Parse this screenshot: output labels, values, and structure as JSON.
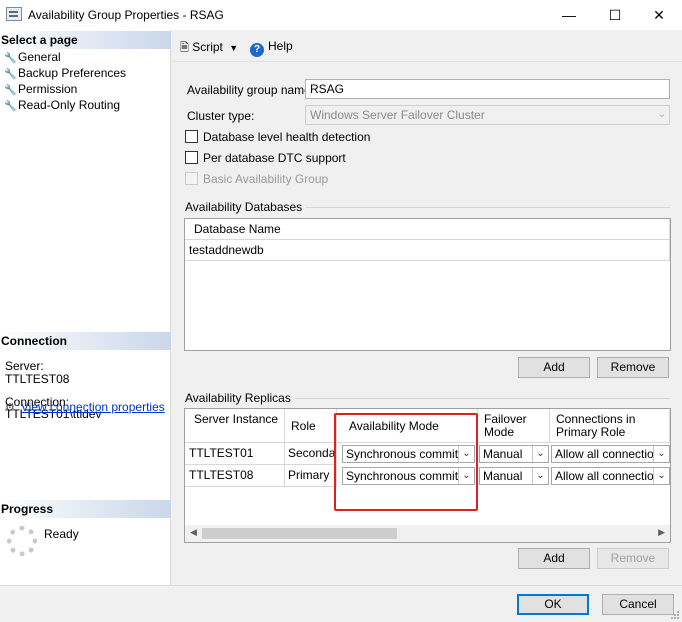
{
  "window": {
    "title": "Availability Group Properties - RSAG"
  },
  "left_pane": {
    "select_page_header": "Select a page",
    "pages": [
      "General",
      "Backup Preferences",
      "Permission",
      "Read-Only Routing"
    ],
    "connection_header": "Connection",
    "server_label": "Server:",
    "server_value": "TTLTEST08",
    "connection_label": "Connection:",
    "connection_value": "TTLTEST01\\ttldev",
    "view_connection_link": "View connection properties",
    "progress_header": "Progress",
    "progress_status": "Ready"
  },
  "toolbar": {
    "script_label": "Script",
    "help_label": "Help"
  },
  "general": {
    "ag_name_label": "Availability group name:",
    "ag_name_value": "RSAG",
    "cluster_type_label": "Cluster type:",
    "cluster_type_value": "Windows Server Failover Cluster",
    "db_health_label": "Database level health detection",
    "dtc_label": "Per database DTC support",
    "basic_ag_label": "Basic Availability Group"
  },
  "databases": {
    "group_title": "Availability Databases",
    "column_header": "Database Name",
    "rows": [
      "testaddnewdb"
    ],
    "add_label": "Add",
    "remove_label": "Remove"
  },
  "replicas": {
    "group_title": "Availability Replicas",
    "headers": {
      "server_instance": "Server Instance",
      "role": "Role",
      "availability_mode": "Availability Mode",
      "failover_mode": "Failover Mode",
      "connections_primary": "Connections in Primary Role"
    },
    "rows": [
      {
        "server": "TTLTEST01",
        "role": "Secondary",
        "mode": "Synchronous commit",
        "failover": "Manual",
        "connections": "Allow all connections"
      },
      {
        "server": "TTLTEST08",
        "role": "Primary",
        "mode": "Synchronous commit",
        "failover": "Manual",
        "connections": "Allow all connections"
      }
    ],
    "add_label": "Add",
    "remove_label": "Remove"
  },
  "footer": {
    "ok_label": "OK",
    "cancel_label": "Cancel"
  },
  "colors": {
    "highlight": "#e02020",
    "link": "#0033cc",
    "accent": "#0078d7"
  }
}
